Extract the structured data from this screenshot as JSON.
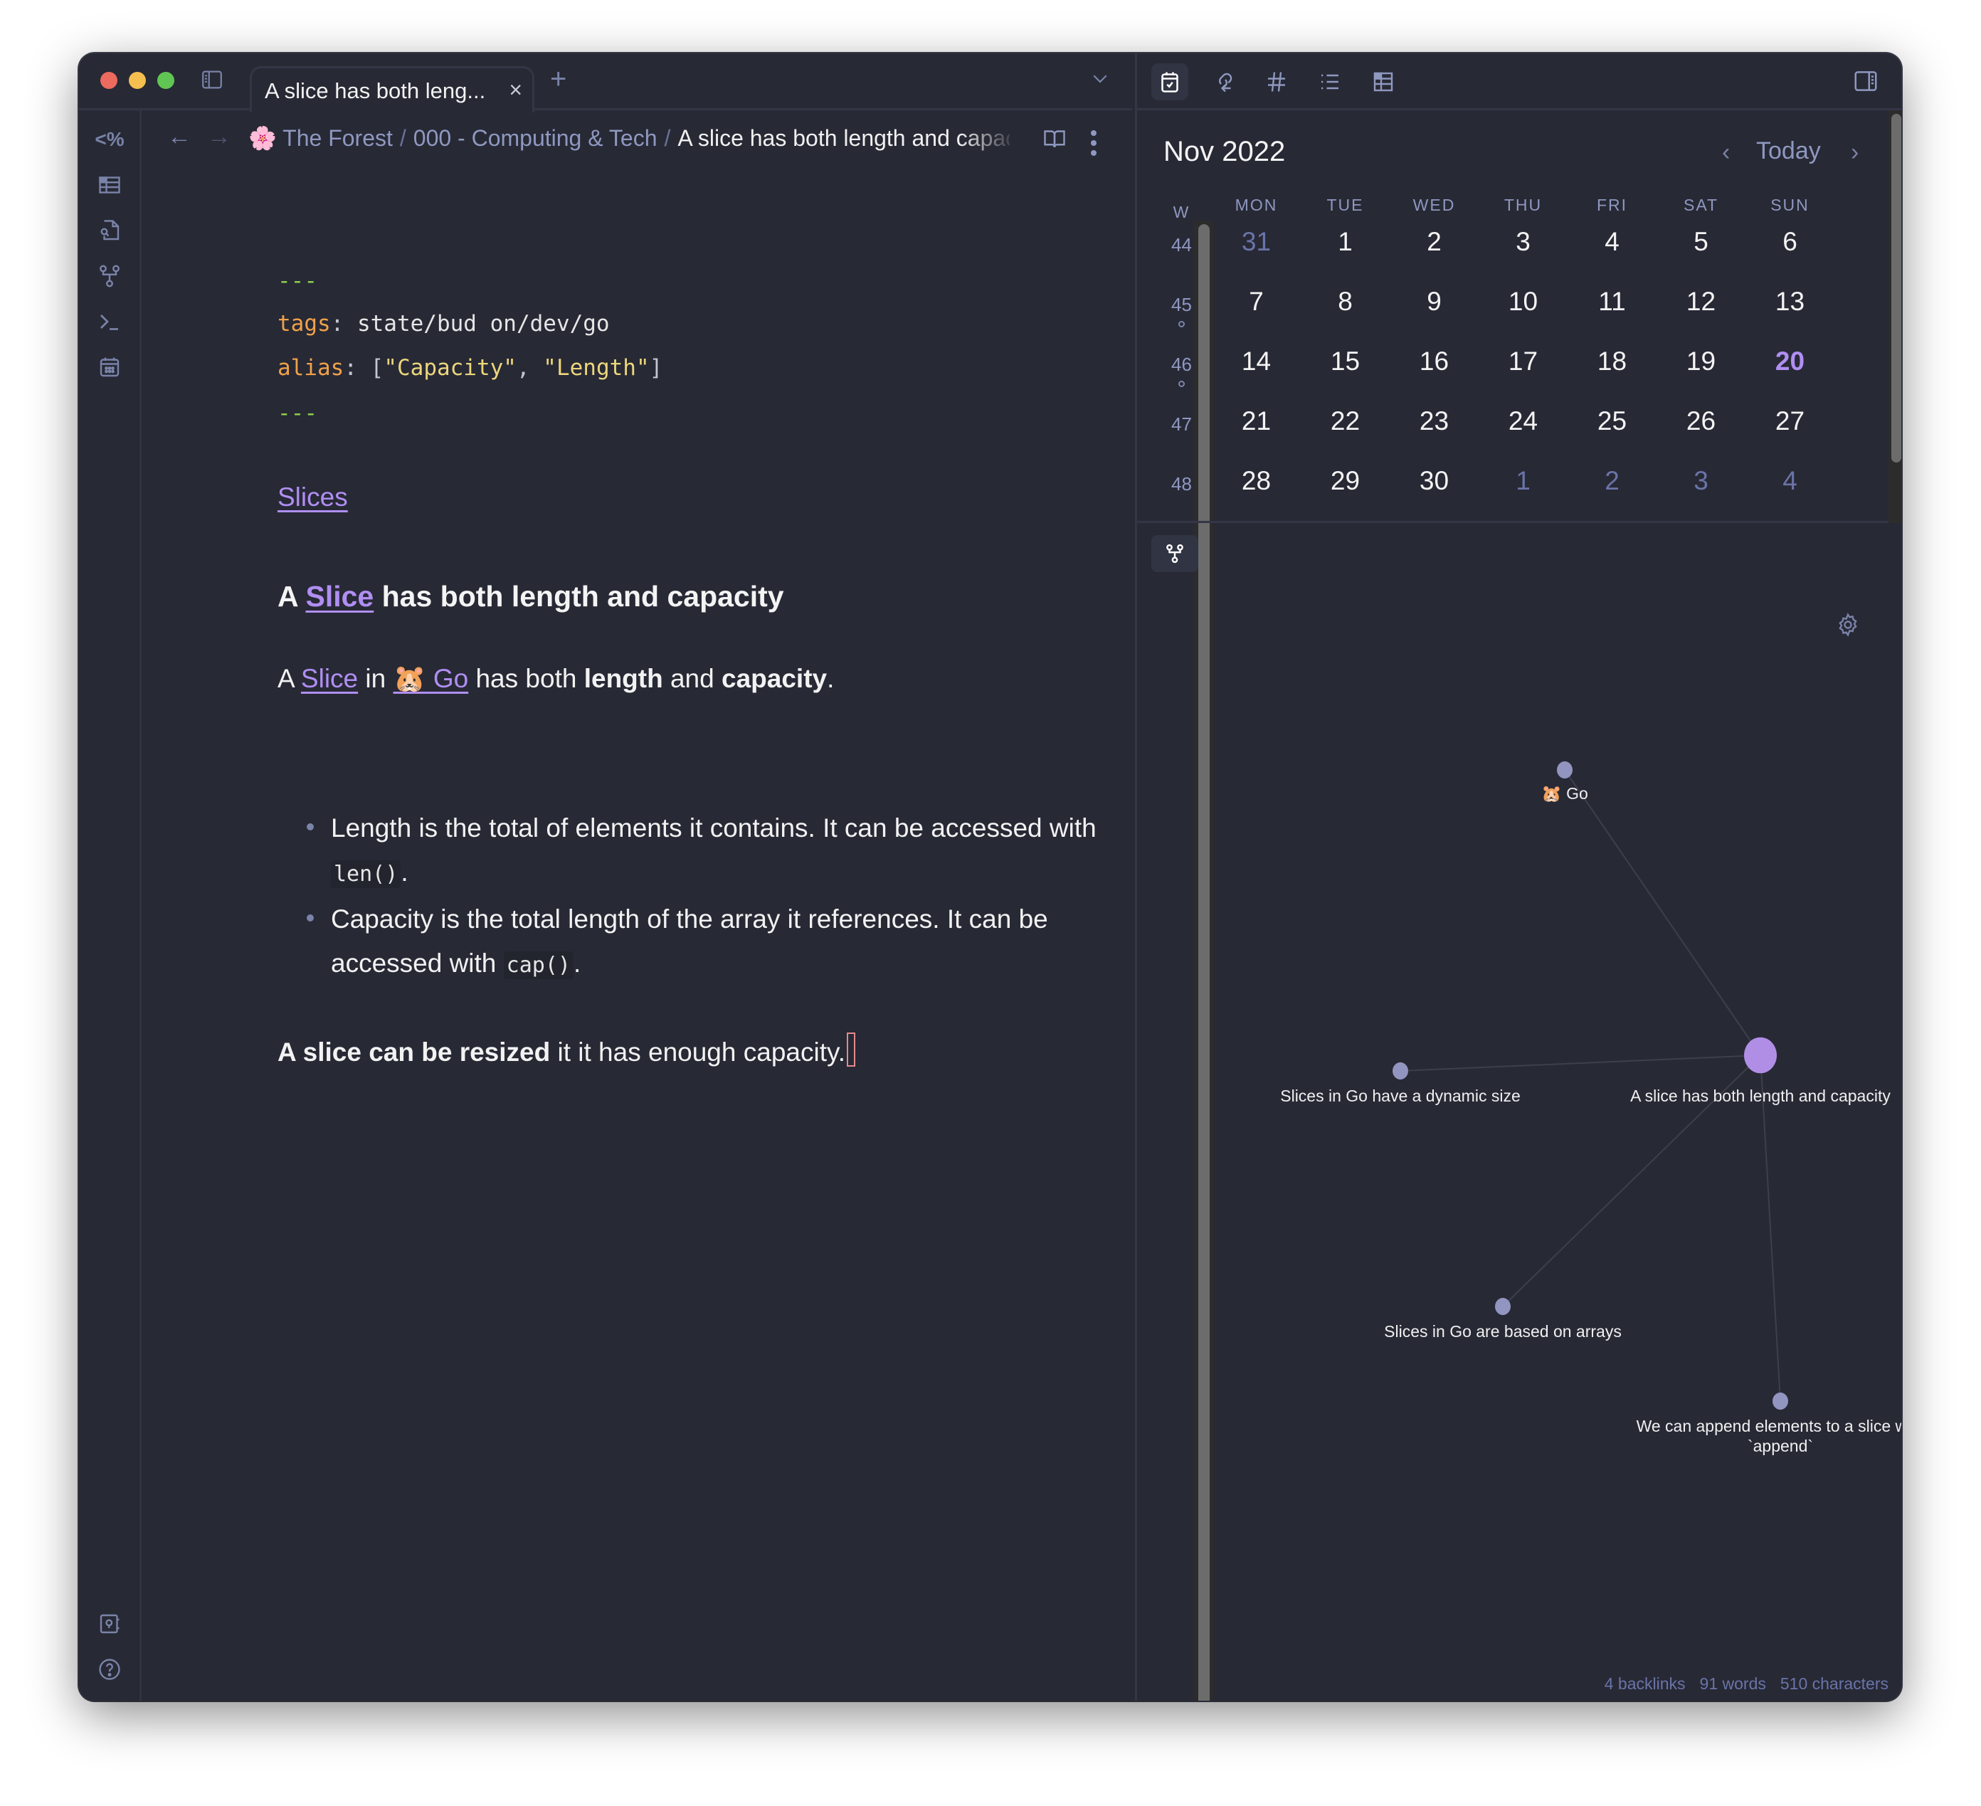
{
  "window": {
    "tab": {
      "title": "A slice has both leng...",
      "close": "×"
    },
    "new_tab": "+"
  },
  "ribbon": {
    "items": [
      {
        "name": "templater",
        "label": "<%"
      },
      {
        "name": "table",
        "icon": "table-icon"
      },
      {
        "name": "search-file",
        "icon": "file-search-icon"
      },
      {
        "name": "graph",
        "icon": "graph-icon"
      },
      {
        "name": "terminal",
        "icon": "terminal-icon"
      },
      {
        "name": "calendar",
        "icon": "calendar-icon"
      }
    ],
    "bottom": [
      {
        "name": "vault",
        "icon": "vault-icon"
      },
      {
        "name": "help",
        "icon": "help-icon"
      },
      {
        "name": "settings",
        "icon": "gear-icon"
      }
    ]
  },
  "navbar": {
    "back": "←",
    "forward": "→",
    "breadcrumb": [
      {
        "label": "🌸 The Forest"
      },
      {
        "label": "000 - Computing & Tech"
      },
      {
        "label": "A slice has both length and capacity"
      }
    ],
    "separator": "/"
  },
  "note": {
    "frontmatter": {
      "delimiter": "---",
      "tags_key": "tags",
      "tags_value": "state/bud on/dev/go",
      "alias_key": "alias",
      "alias_values": [
        "\"Capacity\"",
        "\"Length\""
      ]
    },
    "parent_link": "Slices",
    "heading": {
      "prefix": "A ",
      "link": "Slice",
      "suffix": " has both length and capacity"
    },
    "intro": {
      "a": "A ",
      "slice_link": "Slice",
      "in": " in ",
      "go_link": "🐹 Go",
      "has_both": " has both ",
      "length": "length",
      "and": " and ",
      "capacity": "capacity",
      "period": "."
    },
    "bullets": [
      {
        "text": "Length is the total of elements it contains. It can be accessed with ",
        "code": "len()",
        "end": "."
      },
      {
        "text": "Capacity is the total length of the array it references. It can be accessed with ",
        "code": "cap()",
        "end": "."
      }
    ],
    "closing": {
      "bold": "A slice can be resized",
      "rest": " it it has enough capacity."
    }
  },
  "calendar": {
    "title": "Nov 2022",
    "today_label": "Today",
    "prev": "‹",
    "next": "›",
    "headers": [
      "W",
      "MON",
      "TUE",
      "WED",
      "THU",
      "FRI",
      "SAT",
      "SUN"
    ],
    "weeks": [
      {
        "week": "44",
        "dot": false,
        "days": [
          {
            "d": "31",
            "dim": true
          },
          {
            "d": "1"
          },
          {
            "d": "2"
          },
          {
            "d": "3"
          },
          {
            "d": "4"
          },
          {
            "d": "5"
          },
          {
            "d": "6"
          }
        ]
      },
      {
        "week": "45",
        "dot": true,
        "days": [
          {
            "d": "7"
          },
          {
            "d": "8"
          },
          {
            "d": "9"
          },
          {
            "d": "10"
          },
          {
            "d": "11"
          },
          {
            "d": "12"
          },
          {
            "d": "13"
          }
        ]
      },
      {
        "week": "46",
        "dot": true,
        "days": [
          {
            "d": "14"
          },
          {
            "d": "15"
          },
          {
            "d": "16"
          },
          {
            "d": "17"
          },
          {
            "d": "18"
          },
          {
            "d": "19"
          },
          {
            "d": "20",
            "today": true
          }
        ]
      },
      {
        "week": "47",
        "dot": false,
        "days": [
          {
            "d": "21"
          },
          {
            "d": "22"
          },
          {
            "d": "23"
          },
          {
            "d": "24"
          },
          {
            "d": "25"
          },
          {
            "d": "26"
          },
          {
            "d": "27"
          }
        ]
      },
      {
        "week": "48",
        "dot": false,
        "days": [
          {
            "d": "28"
          },
          {
            "d": "29"
          },
          {
            "d": "30"
          },
          {
            "d": "1",
            "dim": true
          },
          {
            "d": "2",
            "dim": true
          },
          {
            "d": "3",
            "dim": true
          },
          {
            "d": "4",
            "dim": true
          }
        ]
      }
    ]
  },
  "graph": {
    "nodes": [
      {
        "id": "go",
        "label": "🐹 Go",
        "current": false
      },
      {
        "id": "center",
        "label": "A slice has both length and capacity",
        "current": true
      },
      {
        "id": "dynamic",
        "label": "Slices in Go have a dynamic size",
        "current": false
      },
      {
        "id": "arrays",
        "label": "Slices in Go are based on arrays",
        "current": false
      },
      {
        "id": "append",
        "label": "We can append elements to a slice with `append`",
        "current": false
      }
    ],
    "edges": [
      [
        "center",
        "go"
      ],
      [
        "center",
        "dynamic"
      ],
      [
        "center",
        "arrays"
      ],
      [
        "center",
        "append"
      ]
    ],
    "colors": {
      "node": "#9295c0",
      "current": "#b08ee6",
      "edge": "#3d3f4a"
    }
  },
  "status": {
    "backlinks": "4 backlinks",
    "words": "91 words",
    "characters": "510 characters"
  }
}
